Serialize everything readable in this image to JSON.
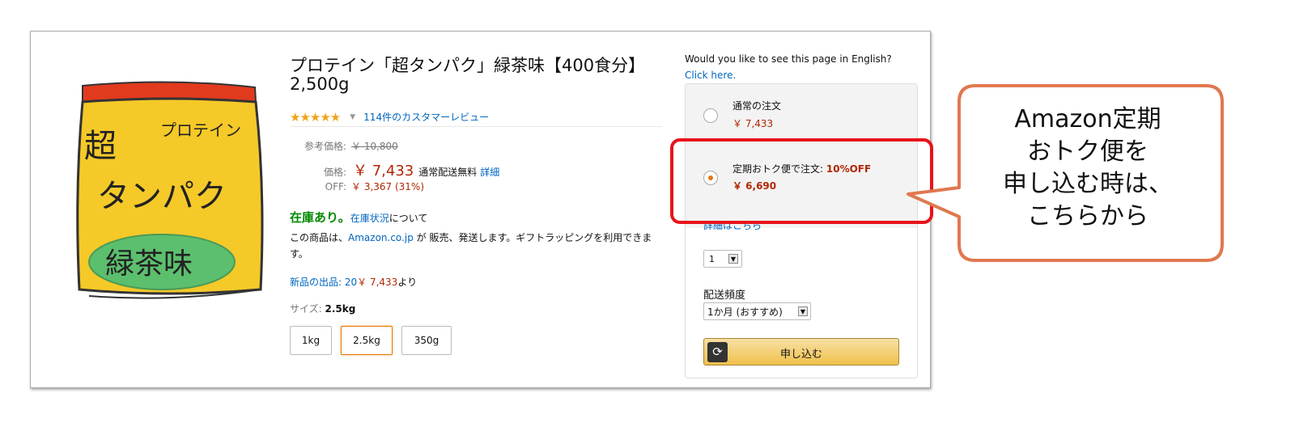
{
  "product": {
    "title_line1": "プロテイン「超タンパク」緑茶味【400食分】",
    "title_line2": "2,500g",
    "image_text": {
      "top_left": "超",
      "top_right": "プロテイン",
      "middle": "タンパク",
      "bottom": "緑茶味"
    },
    "rating_stars": "★★★★★",
    "reviews_link": "114件のカスタマーレビュー",
    "list_price_label": "参考価格:",
    "list_price": "￥ 10,800",
    "price_label": "価格:",
    "price": "￥ 7,433",
    "shipping": "通常配送無料",
    "shipping_details_link": "詳細",
    "off_label": "OFF:",
    "off_value": "￥ 3,367 (31%)",
    "in_stock": "在庫あり。",
    "stock_status_link": "在庫状況",
    "stock_status_suffix": "について",
    "sold_by_prefix": "この商品は、",
    "sold_by_link": "Amazon.co.jp",
    "sold_by_suffix": " が 販売、発送します。ギフトラッピングを利用できます。",
    "new_offers_link": "新品の出品: 20",
    "new_offers_price": "￥ 7,433",
    "new_offers_suffix": "より",
    "size_label": "サイズ:",
    "size_value": "2.5kg",
    "sizes": [
      "1kg",
      "2.5kg",
      "350g"
    ]
  },
  "buybox": {
    "english_prompt": "Would you like to see this page in English?",
    "english_link": "Click here.",
    "regular_label": "通常の注文",
    "regular_price": "￥ 7,433",
    "subscribe_label": "定期おトク便で注文:",
    "subscribe_discount": "10%OFF",
    "subscribe_price": "￥ 6,690",
    "details_link": "詳細はこちら",
    "quantity": "1",
    "frequency_label": "配送頻度",
    "frequency_value": "1か月 (おすすめ)",
    "subscribe_button": "申し込む"
  },
  "callout": {
    "line1": "Amazon定期",
    "line2": "おトク便を",
    "line3": "申し込む時は、",
    "line4": "こちらから"
  },
  "colors": {
    "price_red": "#b12704",
    "link_blue": "#0066c0",
    "stock_green": "#008a00",
    "highlight_red": "#e8131a",
    "bubble_orange": "#e07850",
    "button_gold": "#f0c14b"
  }
}
